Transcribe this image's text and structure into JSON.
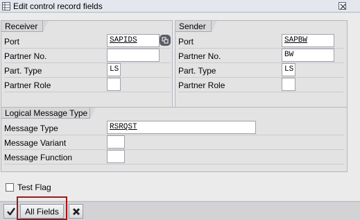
{
  "window": {
    "title": "Edit control record fields",
    "close_label": "Close"
  },
  "receiver": {
    "title": "Receiver",
    "rows": [
      {
        "label": "Port",
        "value": "SAPIDS"
      },
      {
        "label": "Partner No.",
        "value": ""
      },
      {
        "label": "Part. Type",
        "value": "LS"
      },
      {
        "label": "Partner Role",
        "value": ""
      }
    ]
  },
  "sender": {
    "title": "Sender",
    "rows": [
      {
        "label": "Port",
        "value": "SAPBW"
      },
      {
        "label": "Partner No.",
        "value": "BW"
      },
      {
        "label": "Part. Type",
        "value": "LS"
      },
      {
        "label": "Partner Role",
        "value": ""
      }
    ]
  },
  "logical_message": {
    "title": "Logical Message Type",
    "rows": [
      {
        "label": "Message Type",
        "value": "RSRQST"
      },
      {
        "label": "Message Variant",
        "value": ""
      },
      {
        "label": "Message Function",
        "value": ""
      }
    ]
  },
  "test_flag": {
    "label": "Test Flag",
    "checked": false
  },
  "footer": {
    "all_fields_label": "All Fields"
  },
  "colors": {
    "highlight": "#a21818",
    "icon_dark": "#595d66"
  },
  "icons": {
    "title": "table-icon",
    "close": "close-icon",
    "f4": "value-help-icon",
    "confirm": "checkmark-icon",
    "cancel": "cancel-icon"
  }
}
